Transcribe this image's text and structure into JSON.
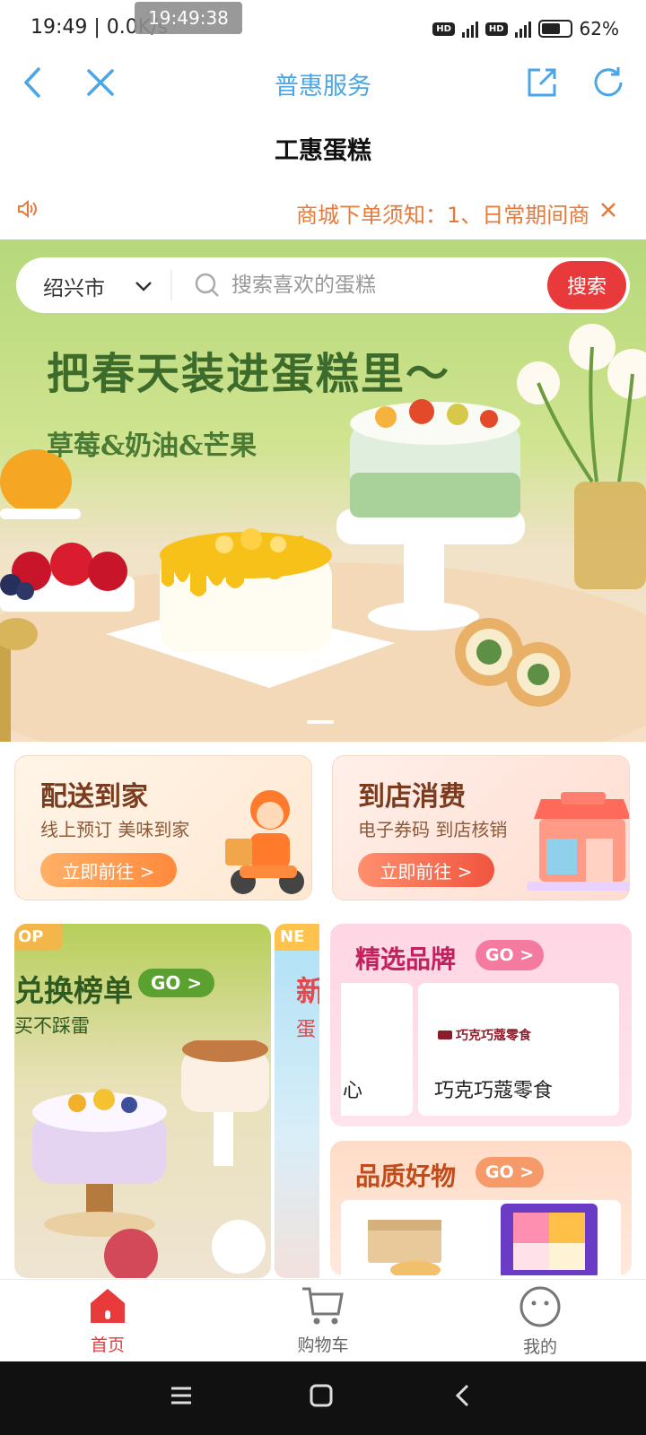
{
  "status_bar": {
    "time_speed": "19:49 | 0.0K/s",
    "overlay_time": "19:49:38",
    "hd1": "HD",
    "hd2": "HD",
    "battery": "62%"
  },
  "app_bar": {
    "title": "普惠服务",
    "icons": [
      "back-icon",
      "close-icon",
      "share-icon",
      "refresh-icon"
    ]
  },
  "page": {
    "title": "工惠蛋糕"
  },
  "notice": {
    "text": "商城下单须知：1、日常期间商"
  },
  "search": {
    "city": "绍兴市",
    "placeholder": "搜索喜欢的蛋糕",
    "button": "搜索"
  },
  "banner": {
    "slogan": "把春天装进蛋糕里～",
    "subtitle": "草莓&奶油&芒果"
  },
  "services": [
    {
      "title": "配送到家",
      "desc": "线上预订 美味到家",
      "button": "立即前往 >"
    },
    {
      "title": "到店消费",
      "desc": "电子券码 到店核销",
      "button": "立即前往 >"
    }
  ],
  "promo_left": {
    "tag": "OP",
    "title": "兑换榜单",
    "go": "GO >",
    "subtitle": "买不踩雷"
  },
  "promo_mid": {
    "tag": "NE",
    "title": "新",
    "subtitle": "蛋"
  },
  "brand_panel": {
    "title": "精选品牌",
    "go": "GO >",
    "brands": [
      "心",
      "巧克巧蔻零食"
    ],
    "brand_logo_text": "巧克巧蔻零食"
  },
  "quality_panel": {
    "title": "品质好物",
    "go": "GO >"
  },
  "bottom_nav": [
    {
      "label": "首页",
      "active": true
    },
    {
      "label": "购物车",
      "active": false
    },
    {
      "label": "我的",
      "active": false
    }
  ],
  "colors": {
    "accent_blue": "#4aa6e6",
    "notice_orange": "#e57a3c",
    "search_red": "#e83a3a",
    "nav_active": "#e83a3a"
  }
}
